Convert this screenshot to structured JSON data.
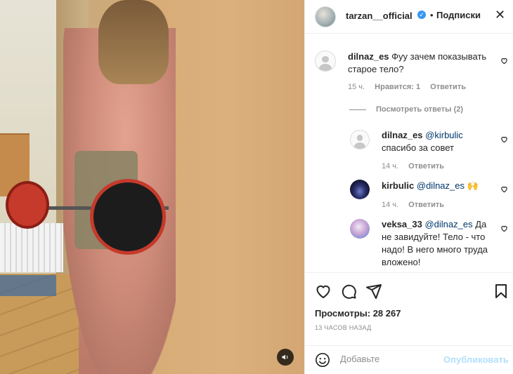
{
  "post": {
    "username": "tarzan__official",
    "follow_label": "Подписки",
    "dot": "•",
    "verified_mark": "✓",
    "close_label": "✕"
  },
  "comments": [
    {
      "username": "dilnaz_es",
      "text": "Фуу зачем показывать старое тело?",
      "time": "15 ч.",
      "likes": "Нравится: 1",
      "reply_label": "Ответить"
    }
  ],
  "view_replies_label": "Посмотреть ответы (2)",
  "replies": [
    {
      "username": "dilnaz_es",
      "mention": "@kirbulic",
      "text": "спасибо за совет",
      "time": "14 ч.",
      "reply_label": "Ответить"
    },
    {
      "username": "kirbulic",
      "mention": "@dilnaz_es",
      "text": "🙌",
      "time": "14 ч.",
      "reply_label": "Ответить"
    },
    {
      "username": "veksa_33",
      "mention": "@dilnaz_es",
      "text": "Да не завидуйте! Тело - что надо! В него много труда вложено!"
    }
  ],
  "stats": {
    "views": "Просмотры: 28 267",
    "posted_ago": "13 часов назад"
  },
  "add_comment": {
    "placeholder": "Добавьте",
    "publish_label": "Опубликовать"
  },
  "icons": {
    "heart": "heart-icon",
    "comment": "comment-icon",
    "share": "share-icon",
    "bookmark": "bookmark-icon",
    "emoji": "emoji-icon",
    "sound": "speaker-icon",
    "verified": "verified-badge-icon",
    "more": "close-icon"
  },
  "colors": {
    "link": "#00376b",
    "verified": "#3897f0",
    "publish_disabled": "#b2dffc",
    "meta": "#8e8e8e"
  }
}
